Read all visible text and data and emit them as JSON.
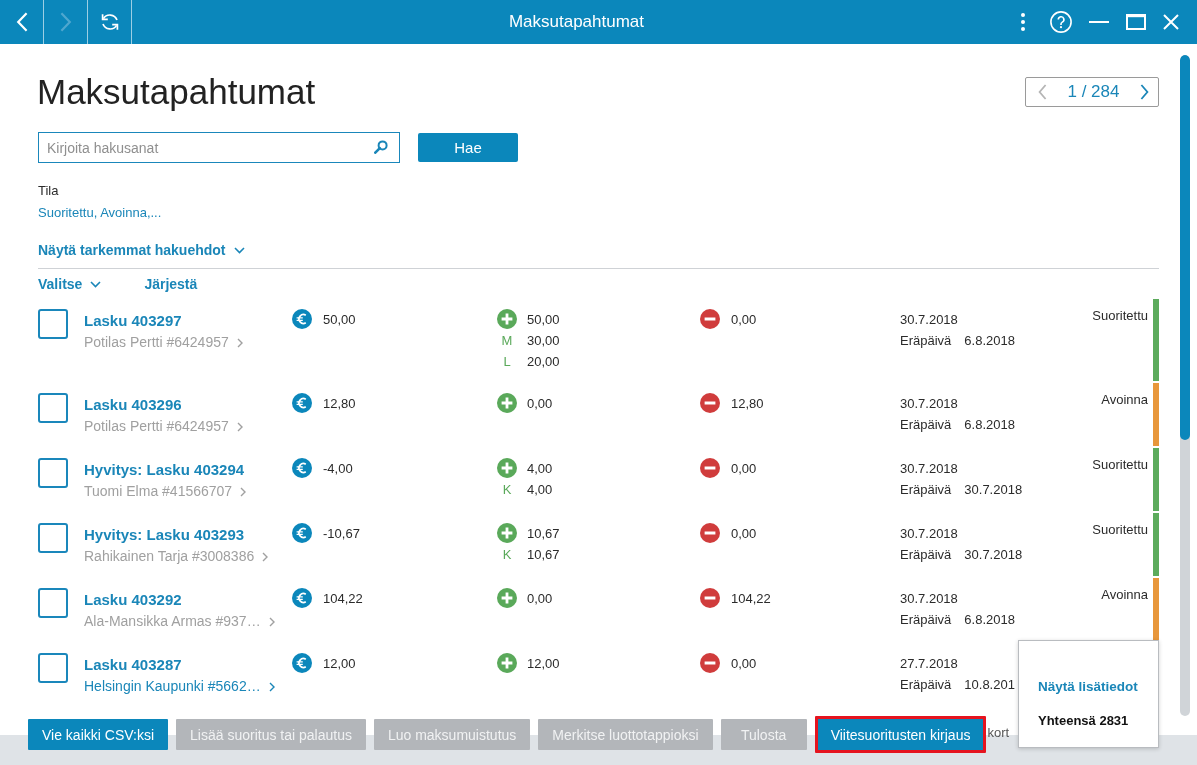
{
  "window": {
    "title": "Maksutapahtumat"
  },
  "nav": [
    {
      "kind": "back",
      "disabled": false
    },
    {
      "kind": "forward",
      "disabled": true
    },
    {
      "kind": "refresh",
      "disabled": false
    }
  ],
  "page_title": "Maksutapahtumat",
  "pager": {
    "text": "1 / 284",
    "prev_disabled": true,
    "next_disabled": false
  },
  "search": {
    "placeholder": "Kirjoita hakusanat",
    "button": "Hae"
  },
  "filter": {
    "label": "Tila",
    "value": "Suoritettu, Avoinna,..."
  },
  "more_filters": "Näytä tarkemmat hakuehdot",
  "list_toolbar": {
    "select": "Valitse",
    "sort": "Järjestä"
  },
  "rows": [
    {
      "checked": false,
      "title": "Lasku 403297",
      "customer": "Potilas Pertti #6424957",
      "customer_highlighted": false,
      "amount": "50,00",
      "paid": "50,00",
      "paid_parts": [
        {
          "code": "M",
          "amount": "30,00"
        },
        {
          "code": "L",
          "amount": "20,00"
        }
      ],
      "remaining": "0,00",
      "date": "30.7.2018",
      "due_label": "Eräpäivä",
      "due_date": "6.8.2018",
      "status": "Suoritettu",
      "color": "#5cab5c"
    },
    {
      "checked": false,
      "title": "Lasku 403296",
      "customer": "Potilas Pertti #6424957",
      "customer_highlighted": false,
      "amount": "12,80",
      "paid": "0,00",
      "remaining": "12,80",
      "date": "30.7.2018",
      "due_label": "Eräpäivä",
      "due_date": "6.8.2018",
      "status": "Avoinna",
      "color": "#e8973b"
    },
    {
      "checked": false,
      "title": "Hyvitys: Lasku 403294",
      "customer": "Tuomi Elma #41566707",
      "customer_highlighted": false,
      "amount": "-4,00",
      "paid": "4,00",
      "paid_parts": [
        {
          "code": "K",
          "amount": "4,00"
        }
      ],
      "remaining": "0,00",
      "date": "30.7.2018",
      "due_label": "Eräpäivä",
      "due_date": "30.7.2018",
      "status": "Suoritettu",
      "color": "#5cab5c"
    },
    {
      "checked": false,
      "title": "Hyvitys: Lasku 403293",
      "customer": "Rahikainen Tarja #3008386",
      "customer_highlighted": false,
      "amount": "-10,67",
      "paid": "10,67",
      "paid_parts": [
        {
          "code": "K",
          "amount": "10,67"
        }
      ],
      "remaining": "0,00",
      "date": "30.7.2018",
      "due_label": "Eräpäivä",
      "due_date": "30.7.2018",
      "status": "Suoritettu",
      "color": "#5cab5c"
    },
    {
      "checked": false,
      "title": "Lasku 403292",
      "customer": "Ala-Mansikka Armas #937…",
      "customer_highlighted": false,
      "amount": "104,22",
      "paid": "0,00",
      "remaining": "104,22",
      "date": "30.7.2018",
      "due_label": "Eräpäivä",
      "due_date": "6.8.2018",
      "status": "Avoinna",
      "color": "#e8973b"
    },
    {
      "checked": false,
      "title": "Lasku 403287",
      "customer": "Helsingin Kaupunki #5662…",
      "customer_highlighted": true,
      "amount": "12,00",
      "paid": "12,00",
      "remaining": "0,00",
      "date": "27.7.2018",
      "due_label": "Eräpäivä",
      "due_date": "10.8.201"
    }
  ],
  "actions": [
    {
      "label": "Vie kaikki CSV:ksi",
      "disabled": false,
      "outlined": false
    },
    {
      "label": "Lisää suoritus tai palautus",
      "disabled": true,
      "outlined": false
    },
    {
      "label": "Luo maksumuistutus",
      "disabled": true,
      "outlined": false
    },
    {
      "label": "Merkitse luottotappioksi",
      "disabled": true,
      "outlined": false
    },
    {
      "label": "Tulosta",
      "disabled": true,
      "outlined": false
    },
    {
      "label": "Viitesuoritusten kirjaus",
      "disabled": false,
      "outlined": true
    }
  ],
  "partial_text": "kort",
  "popup": {
    "link": "Näytä lisätiedot",
    "total": "Yhteensä 2831"
  }
}
